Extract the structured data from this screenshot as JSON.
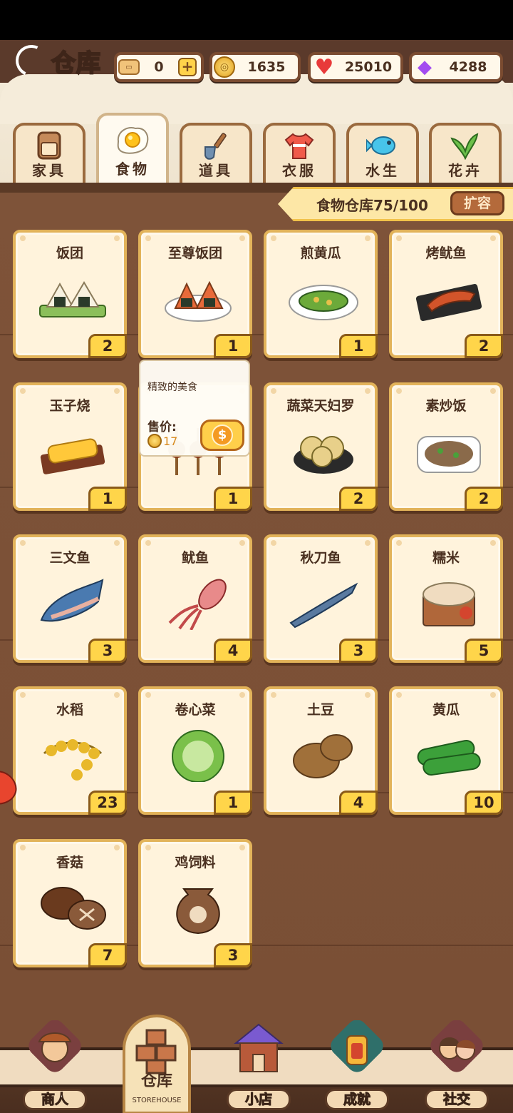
{
  "header": {
    "title": "仓库",
    "currencies": {
      "ticket": "0",
      "coins": "1635",
      "hearts": "25010",
      "gems": "4288"
    }
  },
  "tabs": [
    {
      "label": "家具",
      "icon": "cabinet-icon",
      "active": false
    },
    {
      "label": "食物",
      "icon": "fried-egg-icon",
      "active": true
    },
    {
      "label": "道具",
      "icon": "shovel-icon",
      "active": false
    },
    {
      "label": "衣服",
      "icon": "shirt-icon",
      "active": false
    },
    {
      "label": "水生",
      "icon": "fish-icon",
      "active": false
    },
    {
      "label": "花卉",
      "icon": "plant-icon",
      "active": false
    }
  ],
  "capacity": {
    "text": "食物仓库75/100",
    "expand_label": "扩容"
  },
  "items": [
    {
      "name": "饭团",
      "count": "2",
      "icon": "rice-ball-icon"
    },
    {
      "name": "至尊饭团",
      "count": "1",
      "icon": "supreme-rice-ball-icon"
    },
    {
      "name": "煎黄瓜",
      "count": "1",
      "icon": "fried-cucumber-icon"
    },
    {
      "name": "烤鱿鱼",
      "count": "2",
      "icon": "grilled-squid-icon"
    },
    {
      "name": "玉子烧",
      "count": "1",
      "icon": "tamagoyaki-icon"
    },
    {
      "name": "",
      "count": "1",
      "icon": "mushroom-skewer-icon"
    },
    {
      "name": "蔬菜天妇罗",
      "count": "2",
      "icon": "vegetable-tempura-icon"
    },
    {
      "name": "素炒饭",
      "count": "2",
      "icon": "veggie-fried-rice-icon"
    },
    {
      "name": "三文鱼",
      "count": "3",
      "icon": "salmon-icon"
    },
    {
      "name": "鱿鱼",
      "count": "4",
      "icon": "squid-icon"
    },
    {
      "name": "秋刀鱼",
      "count": "3",
      "icon": "saury-icon"
    },
    {
      "name": "糯米",
      "count": "5",
      "icon": "glutinous-rice-icon"
    },
    {
      "name": "水稻",
      "count": "23",
      "icon": "rice-plant-icon"
    },
    {
      "name": "卷心菜",
      "count": "1",
      "icon": "cabbage-icon"
    },
    {
      "name": "土豆",
      "count": "4",
      "icon": "potato-icon"
    },
    {
      "name": "黄瓜",
      "count": "10",
      "icon": "cucumber-icon"
    },
    {
      "name": "香菇",
      "count": "7",
      "icon": "shiitake-icon"
    },
    {
      "name": "鸡饲料",
      "count": "3",
      "icon": "chicken-feed-icon"
    }
  ],
  "tooltip": {
    "description": "精致的美食",
    "price_label": "售价:",
    "price": "17"
  },
  "nav": [
    {
      "label": "商人",
      "icon": "merchant-icon"
    },
    {
      "label": "仓库",
      "sub": "STOREHOUSE",
      "icon": "storehouse-icon",
      "active": true
    },
    {
      "label": "小店",
      "icon": "shop-icon"
    },
    {
      "label": "成就",
      "icon": "achievement-icon"
    },
    {
      "label": "社交",
      "icon": "social-icon"
    }
  ]
}
